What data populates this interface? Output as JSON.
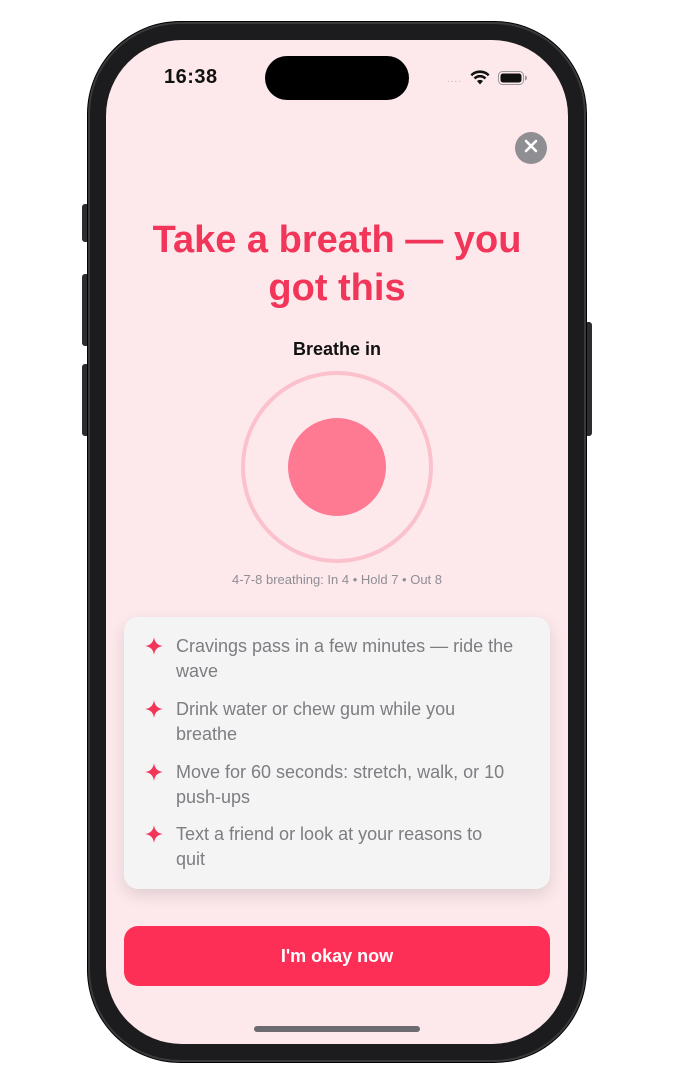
{
  "status_bar": {
    "time": "16:38",
    "signal": "....",
    "icons": [
      "wifi-icon",
      "battery-icon"
    ]
  },
  "close": {
    "icon": "close-icon"
  },
  "headline": "Take a breath — you got this",
  "breathing": {
    "phase_label": "Breathe in",
    "technique": "4-7-8 breathing: In 4 • Hold 7 • Out 8"
  },
  "tips": [
    {
      "icon": "sparkle-icon",
      "text": "Cravings pass in a few minutes — ride the wave"
    },
    {
      "icon": "sparkle-icon",
      "text": "Drink water or chew gum while you breathe"
    },
    {
      "icon": "sparkle-icon",
      "text": "Move for 60 seconds: stretch, walk, or 10 push-ups"
    },
    {
      "icon": "sparkle-icon",
      "text": "Text a friend or look at your reasons to quit"
    }
  ],
  "primary_action": {
    "label": "I'm okay now"
  },
  "colors": {
    "accent": "#f1365a",
    "button": "#fe2f56",
    "background": "#fde9ec",
    "breath_core": "#fe7a93",
    "breath_ring": "#fbc1cc"
  }
}
